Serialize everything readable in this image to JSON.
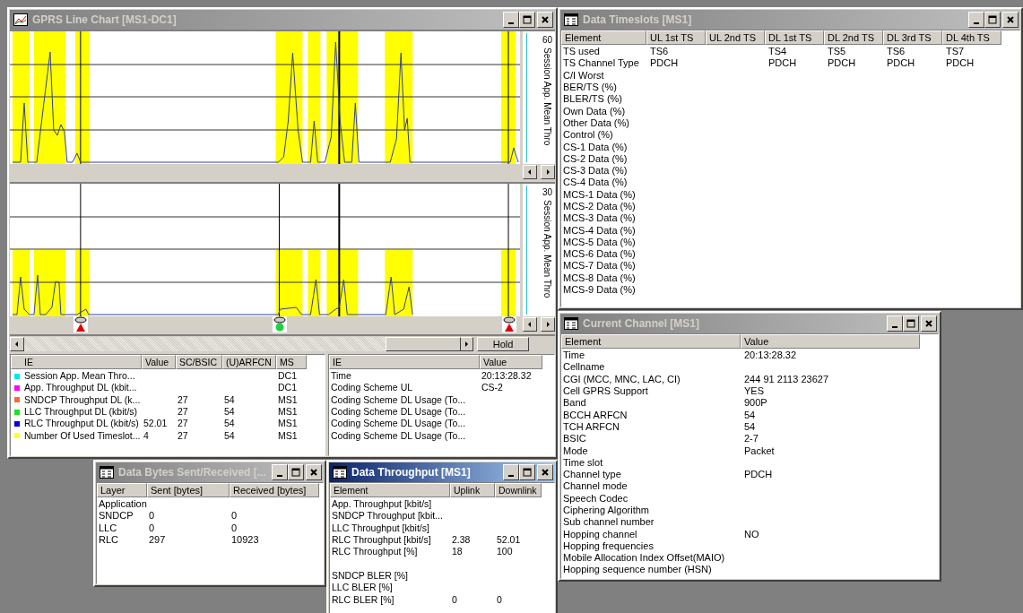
{
  "chart_window": {
    "title": "GPRS Line Chart [MS1-DC1]",
    "active": false,
    "panes": [
      {
        "axis_max": "60",
        "axis_label": "Session App. Mean Thro"
      },
      {
        "axis_max": "30",
        "axis_label": "Session App. Mean Thro"
      }
    ],
    "hold_button": "Hold",
    "legend": {
      "columns": [
        "IE",
        "Value",
        "SC/BSIC",
        "(U)ARFCN",
        "MS"
      ],
      "rows": [
        {
          "color": "#00e5ee",
          "ie": "Session App. Mean Thro...",
          "ms": "DC1"
        },
        {
          "color": "#ff00ff",
          "ie": "App. Throughput DL (kbit...",
          "ms": "DC1"
        },
        {
          "color": "#f07030",
          "ie": "SNDCP Throughput DL (k...",
          "sc_bsic": "27",
          "arfcn": "54",
          "ms": "MS1"
        },
        {
          "color": "#20e020",
          "ie": "LLC Throughput DL (kbit/s)",
          "sc_bsic": "27",
          "arfcn": "54",
          "ms": "MS1"
        },
        {
          "color": "#0000e0",
          "ie": "RLC Throughput DL (kbit/s)",
          "value": "52.01",
          "sc_bsic": "27",
          "arfcn": "54",
          "ms": "MS1"
        },
        {
          "color": "#ffff20",
          "ie": "Number Of Used Timeslot...",
          "value": "4",
          "sc_bsic": "27",
          "arfcn": "54",
          "ms": "MS1"
        }
      ]
    },
    "info": {
      "columns": [
        "IE",
        "Value"
      ],
      "rows": [
        {
          "ie": "Time",
          "value": "20:13:28.32"
        },
        {
          "ie": "Coding Scheme UL",
          "value": "CS-2"
        },
        {
          "ie": "Coding Scheme DL Usage (To..."
        },
        {
          "ie": "Coding Scheme DL Usage (To..."
        },
        {
          "ie": "Coding Scheme DL Usage (To..."
        },
        {
          "ie": "Coding Scheme DL Usage (To..."
        }
      ]
    }
  },
  "data_timeslots": {
    "title": "Data Timeslots [MS1]",
    "active": false,
    "columns": [
      "Element",
      "UL 1st TS",
      "UL 2nd TS",
      "DL 1st TS",
      "DL 2nd TS",
      "DL 3rd TS",
      "DL 4th TS"
    ],
    "rows": [
      {
        "element": "TS used",
        "ul_1st_ts": "TS6",
        "dl_1st_ts": "TS4",
        "dl_2nd_ts": "TS5",
        "dl_3rd_ts": "TS6",
        "dl_4th_ts": "TS7"
      },
      {
        "element": "TS Channel Type",
        "ul_1st_ts": "PDCH",
        "dl_1st_ts": "PDCH",
        "dl_2nd_ts": "PDCH",
        "dl_3rd_ts": "PDCH",
        "dl_4th_ts": "PDCH"
      },
      {
        "element": "C/I Worst"
      },
      {
        "element": "BER/TS (%)"
      },
      {
        "element": "BLER/TS (%)"
      },
      {
        "element": "Own Data (%)"
      },
      {
        "element": "Other Data (%)"
      },
      {
        "element": "Control (%)"
      },
      {
        "element": "CS-1 Data (%)"
      },
      {
        "element": "CS-2 Data (%)"
      },
      {
        "element": "CS-3 Data (%)"
      },
      {
        "element": "CS-4 Data (%)"
      },
      {
        "element": "MCS-1 Data (%)"
      },
      {
        "element": "MCS-2 Data (%)"
      },
      {
        "element": "MCS-3 Data (%)"
      },
      {
        "element": "MCS-4 Data (%)"
      },
      {
        "element": "MCS-5 Data (%)"
      },
      {
        "element": "MCS-6 Data (%)"
      },
      {
        "element": "MCS-7 Data (%)"
      },
      {
        "element": "MCS-8 Data (%)"
      },
      {
        "element": "MCS-9 Data (%)"
      }
    ]
  },
  "current_channel": {
    "title": "Current Channel [MS1]",
    "active": false,
    "columns": [
      "Element",
      "Value"
    ],
    "rows": [
      {
        "element": "Time",
        "value": "20:13:28.32"
      },
      {
        "element": "Cellname"
      },
      {
        "element": "CGI (MCC, MNC, LAC, CI)",
        "value": "244 91 2113 23627"
      },
      {
        "element": "Cell GPRS Support",
        "value": "YES"
      },
      {
        "element": "Band",
        "value": "900P"
      },
      {
        "element": "BCCH ARFCN",
        "value": "54"
      },
      {
        "element": "TCH ARFCN",
        "value": "54"
      },
      {
        "element": "BSIC",
        "value": "2-7"
      },
      {
        "element": "Mode",
        "value": "Packet"
      },
      {
        "element": "Time slot"
      },
      {
        "element": "Channel type",
        "value": "PDCH"
      },
      {
        "element": "Channel mode"
      },
      {
        "element": "Speech Codec"
      },
      {
        "element": "Ciphering Algorithm"
      },
      {
        "element": "Sub channel number"
      },
      {
        "element": "Hopping channel",
        "value": "NO"
      },
      {
        "element": "Hopping frequencies"
      },
      {
        "element": "Mobile Allocation Index Offset(MAIO)"
      },
      {
        "element": "Hopping sequence number (HSN)"
      }
    ]
  },
  "data_bytes": {
    "title": "Data Bytes Sent/Received [...",
    "active": false,
    "columns": [
      "Layer",
      "Sent [bytes]",
      "Received [bytes]"
    ],
    "rows": [
      {
        "layer": "Application"
      },
      {
        "layer": "SNDCP",
        "sent": "0",
        "received": "0"
      },
      {
        "layer": "LLC",
        "sent": "0",
        "received": "0"
      },
      {
        "layer": "RLC",
        "sent": "297",
        "received": "10923"
      }
    ]
  },
  "data_throughput": {
    "title": "Data Throughput [MS1]",
    "active": true,
    "columns": [
      "Element",
      "Uplink",
      "Downlink"
    ],
    "rows": [
      {
        "element": "App. Throughput [kbit/s]"
      },
      {
        "element": "SNDCP Throughput [kbit..."
      },
      {
        "element": "LLC Throughput [kbit/s]"
      },
      {
        "element": "RLC Throughput [kbit/s]",
        "uplink": "2.38",
        "downlink": "52.01"
      },
      {
        "element": "RLC Throughput [%]",
        "uplink": "18",
        "downlink": "100"
      },
      {
        "element": "SNDCP BLER [%]",
        "gap_before": true
      },
      {
        "element": "LLC BLER [%]"
      },
      {
        "element": "RLC BLER [%]",
        "uplink": "0",
        "downlink": "0"
      }
    ]
  }
}
